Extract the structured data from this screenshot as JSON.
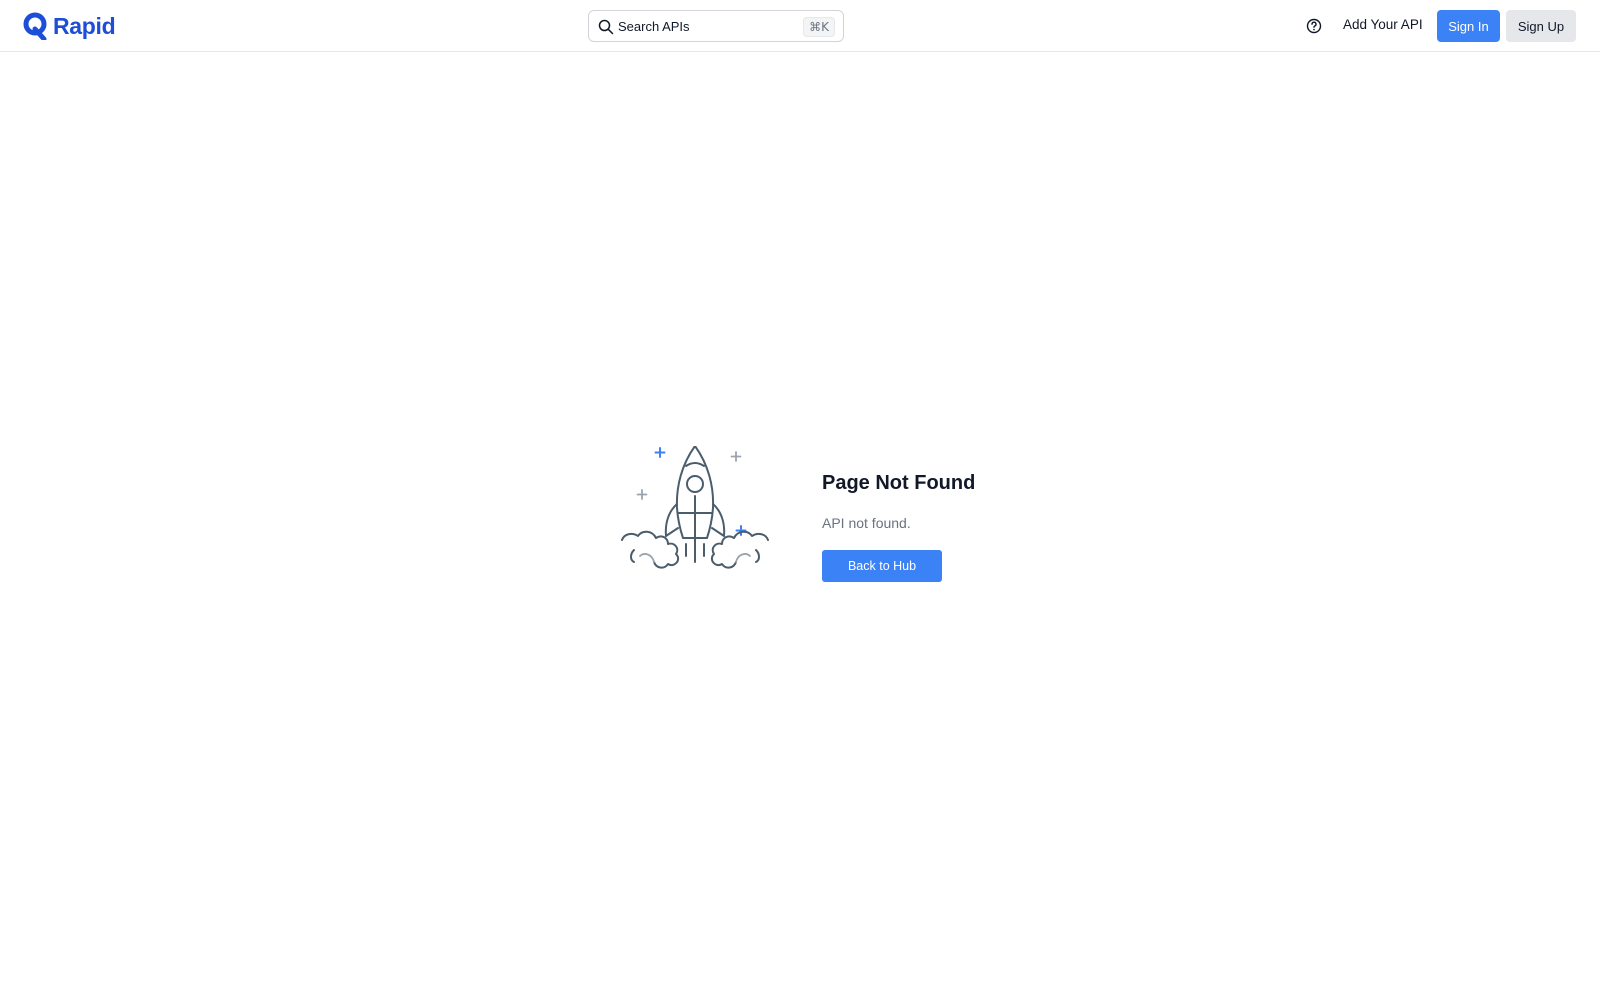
{
  "header": {
    "logo_text": "Rapid",
    "search": {
      "placeholder": "Search APIs",
      "shortcut": "⌘K"
    },
    "help_icon": "question-circle-icon",
    "add_api_label": "Add Your API",
    "sign_in_label": "Sign In",
    "sign_up_label": "Sign Up"
  },
  "main": {
    "title": "Page Not Found",
    "message": "API not found.",
    "back_button_label": "Back to Hub",
    "illustration_icon": "rocket-launch-icon"
  },
  "colors": {
    "brand": "#1d4ed8",
    "primary_button": "#3b82f6",
    "secondary_button": "#e5e7eb",
    "illustration_stroke": "#4b5d6b"
  }
}
